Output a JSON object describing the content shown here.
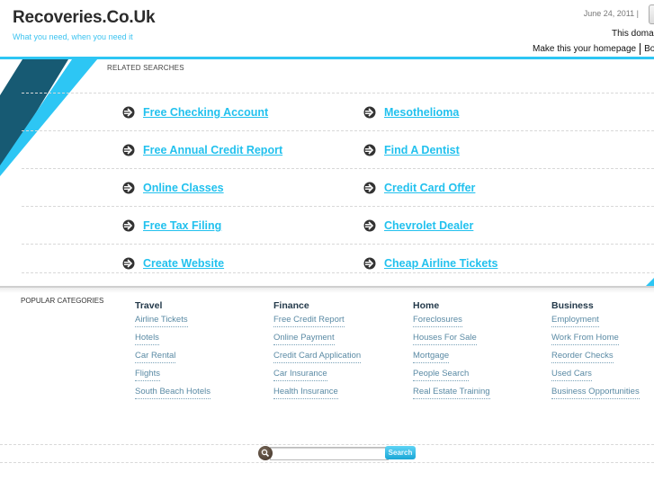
{
  "header": {
    "site_title": "Recoveries.Co.Uk",
    "tagline": "What you need, when you need it",
    "date": "June 24, 2011",
    "date_separator": "|",
    "domain_note": "This doma",
    "make_homepage": "Make this your homepage",
    "bookmark_partial": "Bo"
  },
  "colors": {
    "accent": "#2dc6f4",
    "dark_stripe": "#175a73",
    "link": "#22c1ee",
    "category_link": "#5a8aa4",
    "category_head": "#23394a"
  },
  "related": {
    "label": "RELATED SEARCHES",
    "icon": "circle-arrow-right-icon",
    "rows": [
      {
        "left": "Free Checking Account",
        "right": "Mesothelioma"
      },
      {
        "left": "Free Annual Credit Report",
        "right": "Find A Dentist"
      },
      {
        "left": "Online Classes",
        "right": "Credit Card Offer"
      },
      {
        "left": "Free Tax Filing",
        "right": "Chevrolet Dealer"
      },
      {
        "left": "Create Website",
        "right": "Cheap Airline Tickets"
      }
    ]
  },
  "popular": {
    "label": "POPULAR CATEGORIES",
    "columns": [
      {
        "title": "Travel",
        "links": [
          "Airline Tickets",
          "Hotels",
          "Car Rental",
          "Flights",
          "South Beach Hotels"
        ]
      },
      {
        "title": "Finance",
        "links": [
          "Free Credit Report",
          "Online Payment",
          "Credit Card Application",
          "Car Insurance",
          "Health Insurance"
        ]
      },
      {
        "title": "Home",
        "links": [
          "Foreclosures",
          "Houses For Sale",
          "Mortgage",
          "People Search",
          "Real Estate Training"
        ]
      },
      {
        "title": "Business",
        "links": [
          "Employment",
          "Work From Home",
          "Reorder Checks",
          "Used Cars",
          "Business Opportunities"
        ]
      }
    ]
  },
  "search": {
    "value": "",
    "placeholder": "",
    "button_label": "Search",
    "icon": "magnifier-icon"
  }
}
